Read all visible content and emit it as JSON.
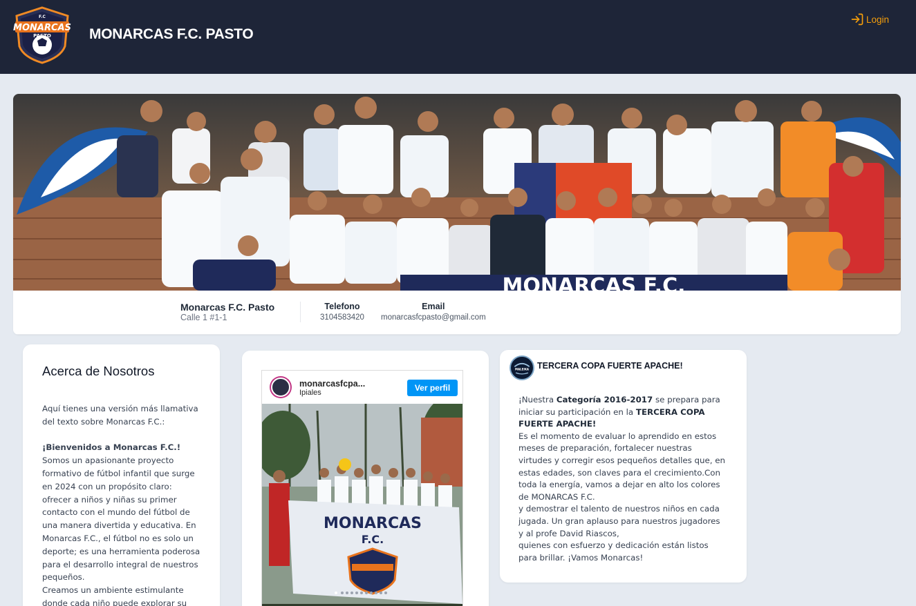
{
  "header": {
    "title": "MONARCAS F.C. PASTO",
    "login_label": "Login",
    "logo_text_top": "F.C",
    "logo_text_main": "MONARCAS",
    "logo_text_bottom": "PASTO"
  },
  "club": {
    "name": "Monarcas F.C. Pasto",
    "address": "Calle 1 #1-1",
    "phone_label": "Telefono",
    "phone": "3104583420",
    "email_label": "Email",
    "email": "monarcasfcpasto@gmail.com",
    "banner_text": "MONARCAS F.C."
  },
  "about": {
    "title": "Acerca de Nosotros",
    "intro": "Aquí tienes una versión más llamativa del texto sobre Monarcas F.C.:",
    "welcome": "¡Bienvenidos a Monarcas F.C.!",
    "body1": "Somos un apasionante proyecto formativo de fútbol infantil que surge en 2024 con un propósito claro: ofrecer a niños y niñas su primer contacto con el mundo del fútbol de una manera divertida y educativa. En Monarcas F.C., el fútbol no es solo un deporte; es una herramienta poderosa para el desarrollo integral de nuestros pequeños.",
    "body2": "Creamos un ambiente estimulante donde cada niño puede explorar su"
  },
  "instagram": {
    "username": "monarcasfcpa...",
    "location": "Ipiales",
    "button_label": "Ver perfil",
    "flag_text": "MONARCAS",
    "flag_sub": "F.C."
  },
  "post": {
    "title": "TERCERA COPA FUERTE APACHE!",
    "avatar_text": "MALEIKA",
    "p1_a": "¡Nuestra ",
    "p1_b": "Categoría 2016-2017",
    "p1_c": " se prepara para iniciar su participación en la ",
    "p1_d": "TERCERA COPA FUERTE APACHE!",
    "p2": "Es el momento de evaluar lo aprendido en estos meses de preparación, fortalecer nuestras virtudes y corregir esos pequeños detalles que, en estas edades, son claves para el crecimiento.Con toda la energía, vamos a dejar en alto los colores de MONARCAS F.C.",
    "p3": " y demostrar el talento de nuestros niños en cada jugada. Un gran aplauso para nuestros jugadores y al profe David Riascos,",
    "p4": "quienes con esfuerzo y dedicación están listos para brillar. ¡Vamos Monarcas!"
  },
  "colors": {
    "header_bg": "#1e2538",
    "accent": "#f59e0b",
    "page_bg": "#e5eaf1",
    "instagram_button": "#0095f6"
  }
}
